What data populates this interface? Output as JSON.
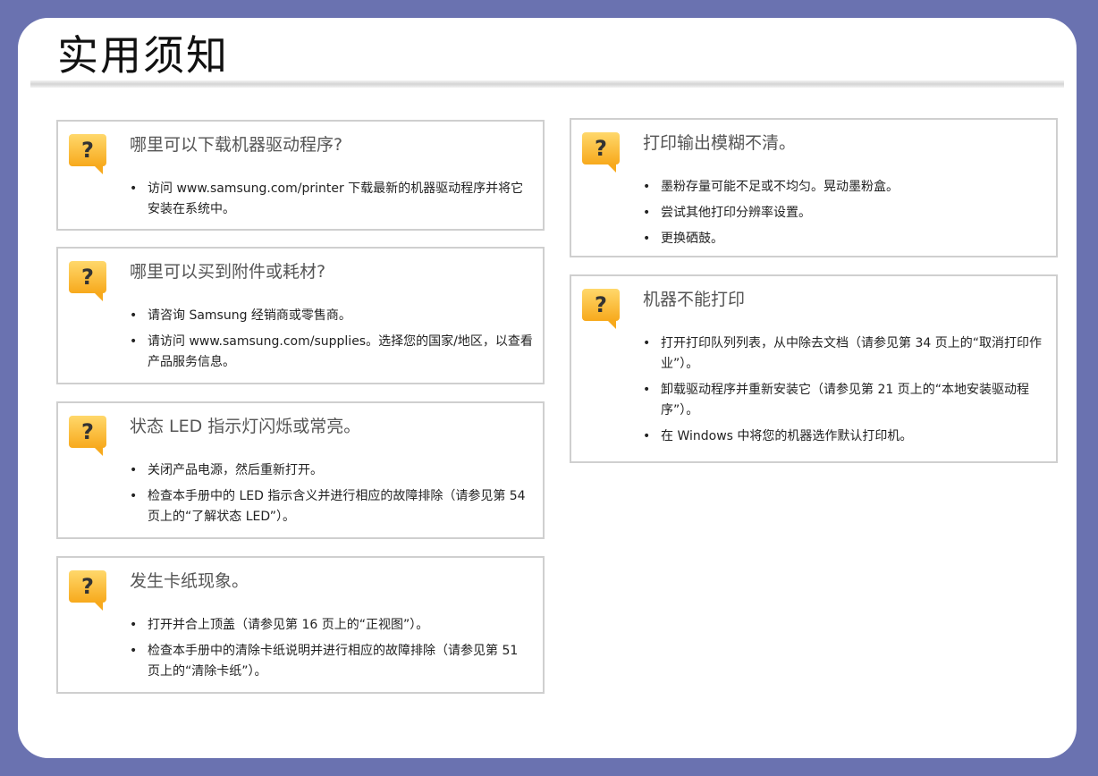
{
  "page_title": "实用须知",
  "cards": [
    {
      "title": "哪里可以下载机器驱动程序?",
      "items": [
        "访问 www.samsung.com/printer 下载最新的机器驱动程序并将它安装在系统中。"
      ]
    },
    {
      "title": "哪里可以买到附件或耗材?",
      "items": [
        "请咨询 Samsung 经销商或零售商。",
        "请访问 www.samsung.com/supplies。选择您的国家/地区，以查看产品服务信息。"
      ]
    },
    {
      "title": "状态 LED 指示灯闪烁或常亮。",
      "items": [
        "关闭产品电源，然后重新打开。",
        "检查本手册中的 LED 指示含义并进行相应的故障排除（请参见第 54 页上的“了解状态 LED”）。"
      ]
    },
    {
      "title": "发生卡纸现象。",
      "items": [
        "打开并合上顶盖（请参见第 16 页上的“正视图”）。",
        "检查本手册中的清除卡纸说明并进行相应的故障排除（请参见第 51 页上的“清除卡纸”）。"
      ]
    },
    {
      "title": "打印输出模糊不清。",
      "items": [
        "墨粉存量可能不足或不均匀。晃动墨粉盒。",
        "尝试其他打印分辨率设置。",
        "更换硒鼓。"
      ]
    },
    {
      "title": "机器不能打印",
      "items": [
        "打开打印队列列表，从中除去文档（请参见第 34 页上的“取消打印作业”）。",
        "卸载驱动程序并重新安装它（请参见第 21 页上的“本地安装驱动程序”）。",
        "在 Windows 中将您的机器选作默认打印机。"
      ]
    }
  ]
}
